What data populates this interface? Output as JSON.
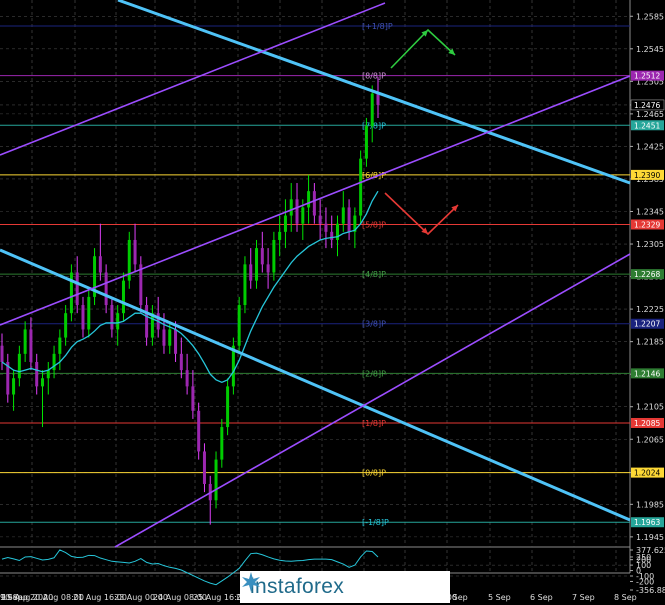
{
  "chart_data": [
    {
      "type": "candlestick",
      "title": "",
      "price_axis": {
        "ticks": [
          "1.2585",
          "1.2545",
          "1.2505",
          "1.2476",
          "1.2465",
          "1.2425",
          "1.2385",
          "1.2345",
          "1.2305",
          "1.2265",
          "1.2225",
          "1.2185",
          "1.2145",
          "1.2105",
          "1.2065",
          "1.2024",
          "1.1985",
          "1.1945"
        ],
        "range": [
          1.1935,
          1.2605
        ]
      },
      "time_axis": {
        "ticks": [
          "19 Aug 2020",
          "20 Aug 08:00",
          "21 Aug 16:00",
          "23 Aug 00:00",
          "24 Aug 08:00",
          "25 Aug 16:00",
          "27 Aug 00:00",
          "27 Aug 16:00",
          "28 Aug 16:00",
          "30 Aug 08:00",
          "31 Aug 16:00",
          "4 Sep",
          "5 Sep",
          "6 Sep",
          "7 Sep",
          "8 Sep",
          "9 Sep",
          "10 Sep"
        ]
      },
      "murrey_levels": [
        {
          "label": "[+1/8]P",
          "value": 1.2573,
          "color": "#1a237e",
          "text_color": "#3f51b5",
          "show_badge": false
        },
        {
          "label": "[8/8]P",
          "value": 1.2512,
          "color": "#9c27b0",
          "text_color": "#ce93d8",
          "show_badge": true
        },
        {
          "label": "[7/8]P",
          "value": 1.2451,
          "color": "#26a69a",
          "text_color": "#26c6da",
          "show_badge": true
        },
        {
          "label": "[6/8]P",
          "value": 1.239,
          "color": "#fdd835",
          "text_color": "#fdd835",
          "show_badge": true
        },
        {
          "label": "[5/8]P",
          "value": 1.2329,
          "color": "#e53935",
          "text_color": "#e53935",
          "show_badge": true
        },
        {
          "label": "[4/8]P",
          "value": 1.2268,
          "color": "#2e7d32",
          "text_color": "#43a047",
          "show_badge": true
        },
        {
          "label": "[3/8]P",
          "value": 1.2207,
          "color": "#1a237e",
          "text_color": "#3f51b5",
          "show_badge": true
        },
        {
          "label": "[2/8]P",
          "value": 1.2146,
          "color": "#2e7d32",
          "text_color": "#43a047",
          "show_badge": true
        },
        {
          "label": "[1/8]P",
          "value": 1.2085,
          "color": "#e53935",
          "text_color": "#e53935",
          "show_badge": true
        },
        {
          "label": "[0/8]P",
          "value": 1.2024,
          "color": "#fdd835",
          "text_color": "#fdd835",
          "show_badge": true
        },
        {
          "label": "[-1/8]P",
          "value": 1.1963,
          "color": "#26a69a",
          "text_color": "#26c6da",
          "show_badge": true
        }
      ],
      "current_price": "1.2476",
      "candles": [
        [
          1.218,
          1.2195,
          1.215,
          1.216
        ],
        [
          1.216,
          1.217,
          1.211,
          1.212
        ],
        [
          1.212,
          1.215,
          1.21,
          1.214
        ],
        [
          1.214,
          1.218,
          1.213,
          1.217
        ],
        [
          1.217,
          1.221,
          1.216,
          1.22
        ],
        [
          1.22,
          1.2215,
          1.215,
          1.216
        ],
        [
          1.216,
          1.217,
          1.212,
          1.213
        ],
        [
          1.213,
          1.215,
          1.208,
          1.214
        ],
        [
          1.214,
          1.216,
          1.212,
          1.215
        ],
        [
          1.215,
          1.218,
          1.214,
          1.217
        ],
        [
          1.217,
          1.22,
          1.215,
          1.219
        ],
        [
          1.219,
          1.223,
          1.218,
          1.222
        ],
        [
          1.222,
          1.228,
          1.221,
          1.227
        ],
        [
          1.227,
          1.229,
          1.222,
          1.223
        ],
        [
          1.223,
          1.224,
          1.219,
          1.22
        ],
        [
          1.22,
          1.225,
          1.219,
          1.224
        ],
        [
          1.224,
          1.23,
          1.223,
          1.229
        ],
        [
          1.229,
          1.233,
          1.226,
          1.227
        ],
        [
          1.227,
          1.228,
          1.222,
          1.223
        ],
        [
          1.223,
          1.224,
          1.219,
          1.22
        ],
        [
          1.22,
          1.223,
          1.218,
          1.222
        ],
        [
          1.222,
          1.227,
          1.221,
          1.226
        ],
        [
          1.226,
          1.232,
          1.225,
          1.231
        ],
        [
          1.231,
          1.233,
          1.227,
          1.228
        ],
        [
          1.228,
          1.229,
          1.222,
          1.223
        ],
        [
          1.223,
          1.224,
          1.218,
          1.219
        ],
        [
          1.219,
          1.223,
          1.218,
          1.222
        ],
        [
          1.222,
          1.224,
          1.219,
          1.22
        ],
        [
          1.22,
          1.222,
          1.217,
          1.218
        ],
        [
          1.218,
          1.221,
          1.217,
          1.22
        ],
        [
          1.22,
          1.221,
          1.216,
          1.217
        ],
        [
          1.217,
          1.219,
          1.214,
          1.215
        ],
        [
          1.215,
          1.217,
          1.212,
          1.213
        ],
        [
          1.213,
          1.215,
          1.209,
          1.21
        ],
        [
          1.21,
          1.211,
          1.204,
          1.205
        ],
        [
          1.205,
          1.206,
          1.2,
          1.201
        ],
        [
          1.201,
          1.202,
          1.196,
          1.199
        ],
        [
          1.199,
          1.205,
          1.198,
          1.204
        ],
        [
          1.204,
          1.209,
          1.203,
          1.208
        ],
        [
          1.208,
          1.214,
          1.207,
          1.213
        ],
        [
          1.213,
          1.219,
          1.212,
          1.218
        ],
        [
          1.218,
          1.224,
          1.217,
          1.223
        ],
        [
          1.223,
          1.229,
          1.222,
          1.228
        ],
        [
          1.228,
          1.23,
          1.225,
          1.226
        ],
        [
          1.226,
          1.231,
          1.225,
          1.23
        ],
        [
          1.23,
          1.232,
          1.227,
          1.228
        ],
        [
          1.228,
          1.23,
          1.225,
          1.227
        ],
        [
          1.227,
          1.232,
          1.226,
          1.231
        ],
        [
          1.231,
          1.234,
          1.229,
          1.232
        ],
        [
          1.232,
          1.236,
          1.23,
          1.234
        ],
        [
          1.234,
          1.238,
          1.232,
          1.236
        ],
        [
          1.236,
          1.238,
          1.232,
          1.233
        ],
        [
          1.233,
          1.236,
          1.231,
          1.235
        ],
        [
          1.235,
          1.239,
          1.233,
          1.237
        ],
        [
          1.237,
          1.238,
          1.233,
          1.234
        ],
        [
          1.234,
          1.236,
          1.231,
          1.233
        ],
        [
          1.233,
          1.235,
          1.23,
          1.232
        ],
        [
          1.232,
          1.234,
          1.23,
          1.231
        ],
        [
          1.231,
          1.234,
          1.229,
          1.233
        ],
        [
          1.233,
          1.237,
          1.232,
          1.235
        ],
        [
          1.235,
          1.236,
          1.231,
          1.232
        ],
        [
          1.232,
          1.235,
          1.23,
          1.234
        ],
        [
          1.234,
          1.242,
          1.233,
          1.241
        ],
        [
          1.241,
          1.246,
          1.24,
          1.245
        ],
        [
          1.245,
          1.25,
          1.243,
          1.249
        ],
        [
          1.249,
          1.251,
          1.246,
          1.2476
        ]
      ],
      "ma": [
        1.216,
        1.2155,
        1.215,
        1.2148,
        1.215,
        1.2152,
        1.215,
        1.2148,
        1.215,
        1.2155,
        1.216,
        1.2168,
        1.2178,
        1.2185,
        1.2188,
        1.2192,
        1.2198,
        1.2205,
        1.2208,
        1.2208,
        1.2208,
        1.221,
        1.2215,
        1.222,
        1.222,
        1.2216,
        1.2213,
        1.221,
        1.2206,
        1.2203,
        1.22,
        1.2195,
        1.2188,
        1.218,
        1.217,
        1.2158,
        1.2145,
        1.2138,
        1.2135,
        1.2138,
        1.2148,
        1.2162,
        1.218,
        1.2198,
        1.2213,
        1.2228,
        1.224,
        1.2252,
        1.2262,
        1.2272,
        1.2282,
        1.229,
        1.2296,
        1.2302,
        1.2306,
        1.231,
        1.2312,
        1.2313,
        1.2314,
        1.2318,
        1.232,
        1.2322,
        1.233,
        1.2342,
        1.2358,
        1.237
      ]
    },
    {
      "type": "line",
      "title": "",
      "ticks": [
        "377.6254",
        "250",
        "200",
        "100",
        "0",
        "-100",
        "-200",
        "-356.8854"
      ],
      "range": [
        -356.8854,
        377.6254
      ],
      "values": [
        210,
        240,
        215,
        185,
        250,
        255,
        225,
        195,
        205,
        235,
        380,
        330,
        260,
        240,
        245,
        280,
        275,
        230,
        200,
        170,
        160,
        150,
        140,
        170,
        220,
        150,
        120,
        130,
        90,
        60,
        40,
        10,
        -40,
        -90,
        -140,
        -190,
        -230,
        -260,
        -190,
        -120,
        -40,
        40,
        180,
        310,
        320,
        290,
        250,
        215,
        190,
        175,
        170,
        180,
        185,
        200,
        210,
        210,
        210,
        200,
        160,
        120,
        60,
        100,
        250,
        360,
        350,
        250
      ]
    }
  ],
  "watermark": {
    "text": "instaforex"
  }
}
